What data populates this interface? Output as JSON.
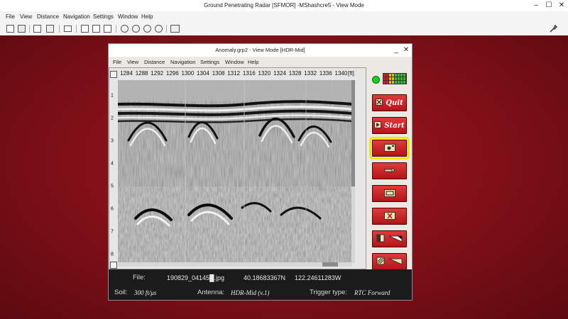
{
  "app": {
    "title": "Ground Penetrating Radar [SFMOR] -MShashcre5 - View Mode",
    "menu": [
      "File",
      "View",
      "Distance",
      "Navigation",
      "Settings",
      "Window",
      "Help"
    ]
  },
  "outer_controls": {
    "minimize": "–",
    "restore": "☐",
    "close": "✕"
  },
  "inner_window": {
    "title": "Anomaly.grp2 - View Mode [HDR-Mid]",
    "menu": [
      "File",
      "View",
      "Distance",
      "Navigation",
      "Settings",
      "Window",
      "Help"
    ],
    "controls": {
      "minimize": "_",
      "close": "✕"
    }
  },
  "ruler": {
    "top_ticks": [
      "1284",
      "1288",
      "1292",
      "1296",
      "1300",
      "1304",
      "1308",
      "1312",
      "1316",
      "1320",
      "1324",
      "1328",
      "1332",
      "1336",
      "1340"
    ],
    "unit": "[ft]",
    "depth_ticks": [
      "1",
      "2",
      "3",
      "4",
      "5",
      "6",
      "7",
      "8"
    ]
  },
  "controls": {
    "quit_label": "Quit",
    "start_label": "Start"
  },
  "info": {
    "file_label": "File:",
    "file_name": "190829_04145█.jpg",
    "lat": "40.18683367N",
    "lon": "122.24611283W",
    "soil_label": "Soil:",
    "soil_value": "300 ft/μs",
    "antenna_label": "Antenna:",
    "antenna_value": "HDR-Mid (v.1)",
    "trigger_label": "Trigger type:",
    "trigger_value": "RTC Forward"
  },
  "colors": {
    "desktop": "#861019",
    "button_red": "#c8202a",
    "selection_yellow": "#f0e600",
    "info_bar": "#1b1b1b"
  }
}
